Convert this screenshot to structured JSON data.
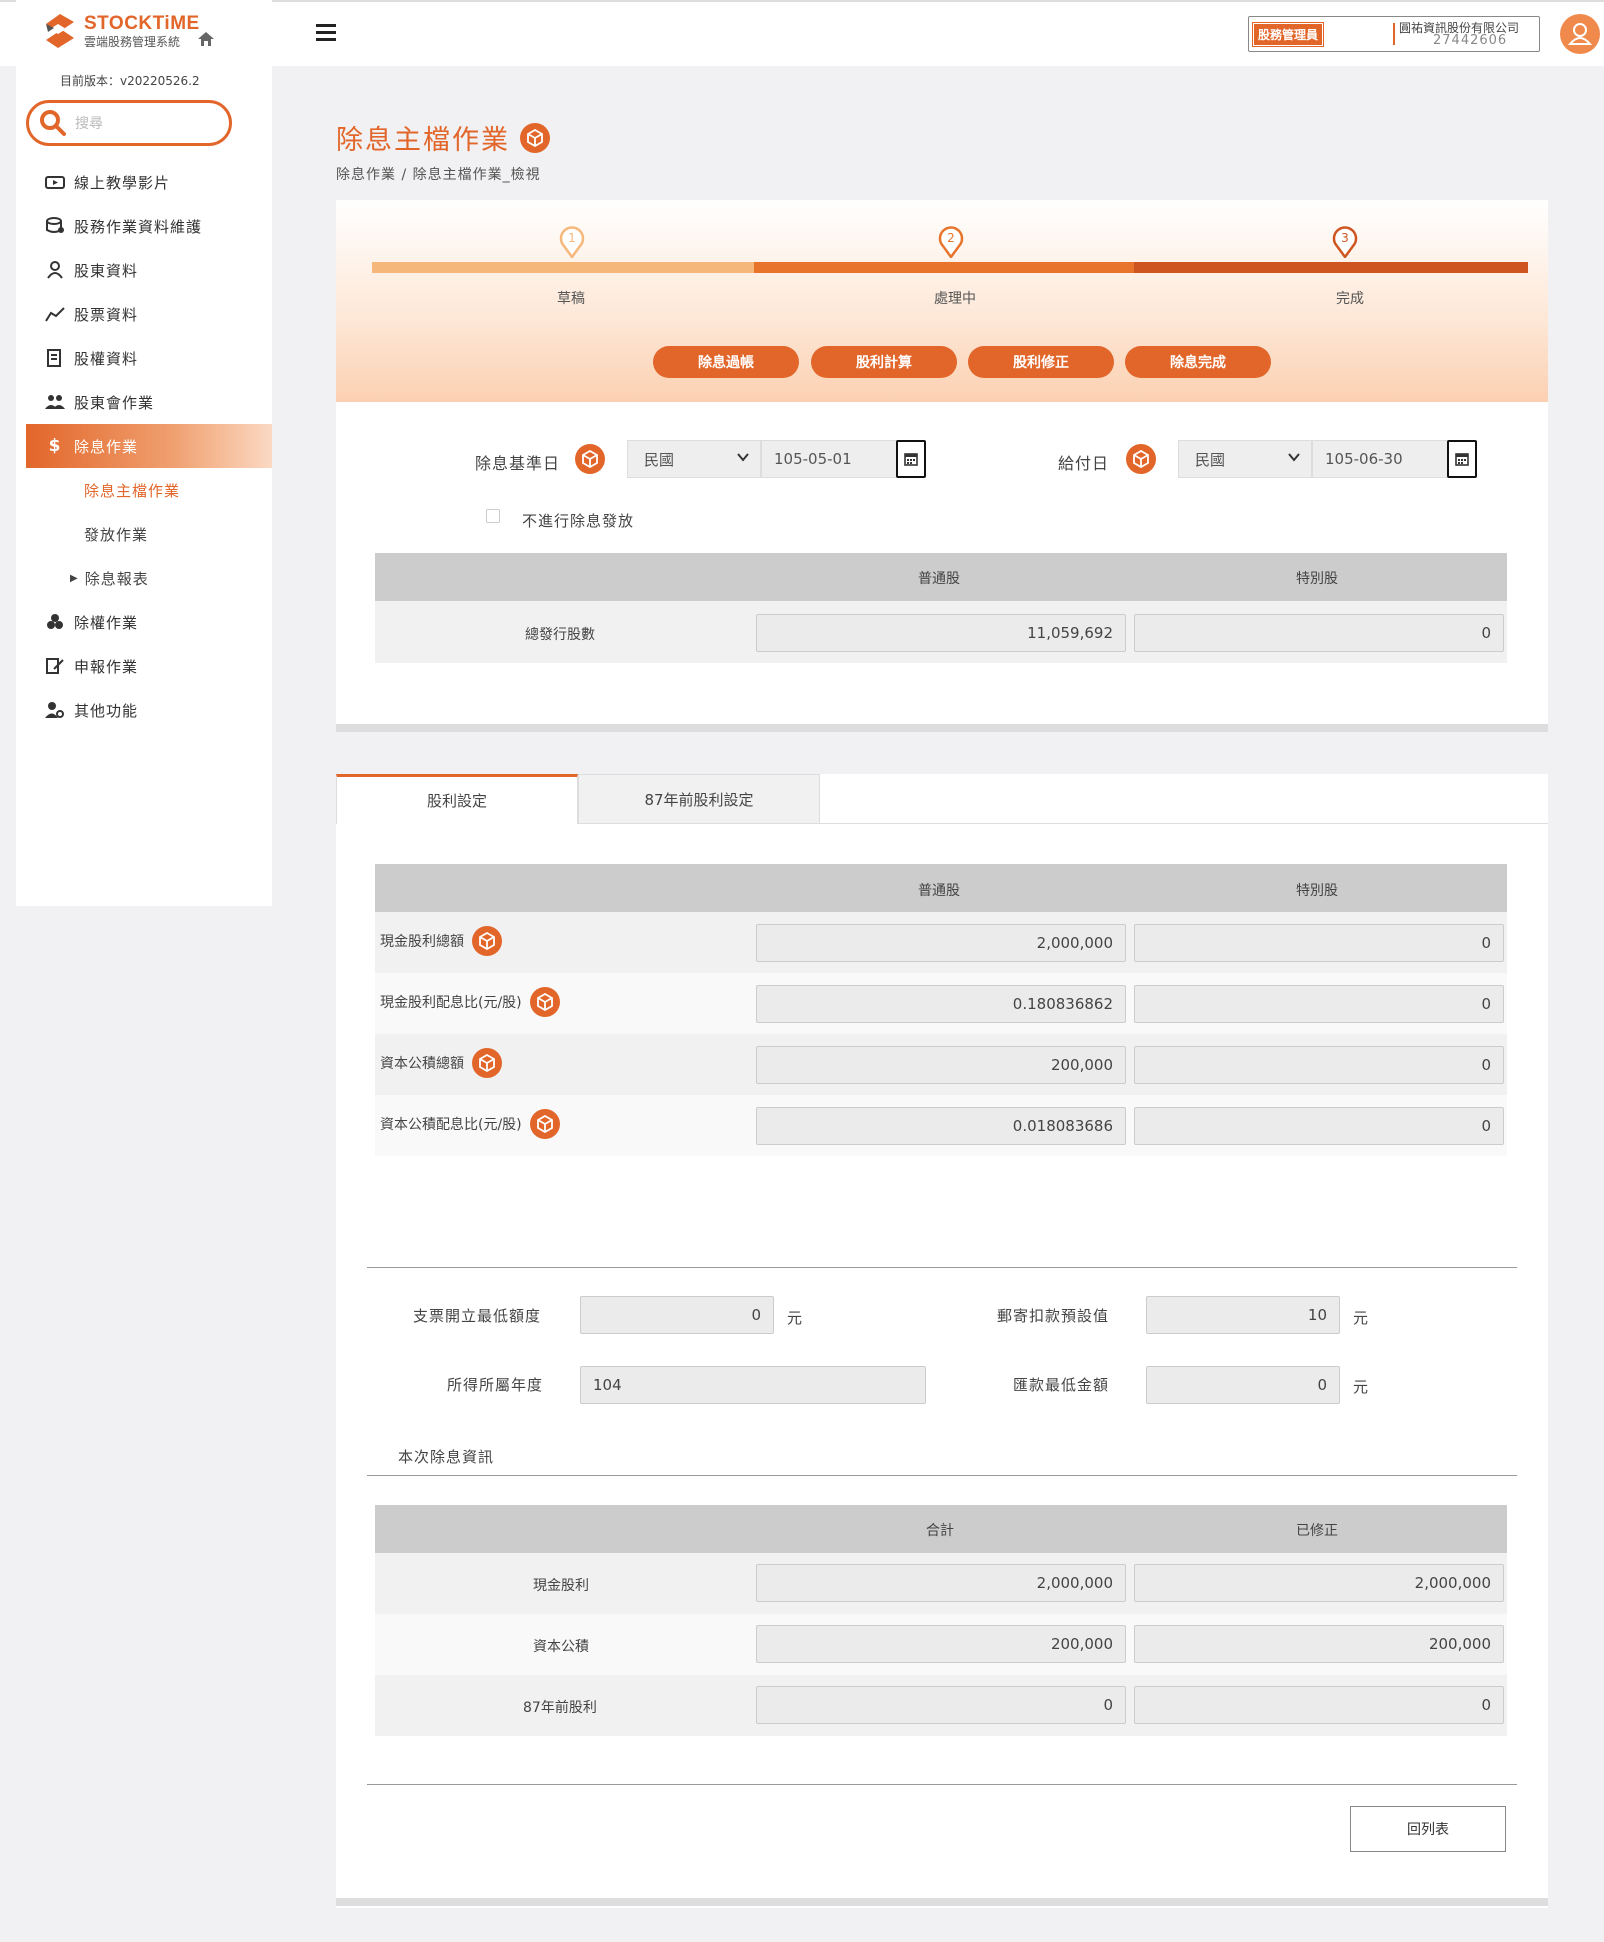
{
  "app": {
    "brand": "STOCKTiME",
    "subtitle": "雲端股務管理系統",
    "version": "目前版本：v20220526.2"
  },
  "search": {
    "placeholder": "搜尋"
  },
  "sidebar": {
    "items": [
      {
        "label": "線上教學影片"
      },
      {
        "label": "股務作業資料維護"
      },
      {
        "label": "股東資料"
      },
      {
        "label": "股票資料"
      },
      {
        "label": "股權資料"
      },
      {
        "label": "股東會作業"
      },
      {
        "label": "除息作業"
      },
      {
        "label": "除權作業"
      },
      {
        "label": "申報作業"
      },
      {
        "label": "其他功能"
      }
    ],
    "sub_items": [
      {
        "label": "除息主檔作業"
      },
      {
        "label": "發放作業"
      },
      {
        "label": "除息報表"
      }
    ]
  },
  "header": {
    "role": "股務管理員",
    "company": "圓祐資訊股份有限公司",
    "company_id": "27442606"
  },
  "page": {
    "title": "除息主檔作業",
    "breadcrumb": "除息作業  /  除息主檔作業_檢視"
  },
  "stepper": {
    "steps": [
      {
        "num": "1",
        "label": "草稿"
      },
      {
        "num": "2",
        "label": "處理中"
      },
      {
        "num": "3",
        "label": "完成"
      }
    ],
    "colors": {
      "step1": "#f5b87a",
      "step2": "#e8742c",
      "step3": "#cf5520"
    },
    "actions": [
      "除息過帳",
      "股利計算",
      "股利修正",
      "除息完成"
    ]
  },
  "form": {
    "base_date_label": "除息基準日",
    "base_era": "民國",
    "base_date": "105-05-01",
    "pay_date_label": "給付日",
    "pay_era": "民國",
    "pay_date": "105-06-30",
    "no_dividend_label": "不進行除息發放",
    "share_table": {
      "col1": "普通股",
      "col2": "特別股",
      "row_label": "總發行股數",
      "common": "11,059,692",
      "special": "0"
    }
  },
  "tabs": [
    "股利設定",
    "87年前股利設定"
  ],
  "dividend_table": {
    "col1": "普通股",
    "col2": "特別股",
    "rows": [
      {
        "label": "現金股利總額",
        "common": "2,000,000",
        "special": "0"
      },
      {
        "label": "現金股利配息比(元/股)",
        "common": "0.180836862",
        "special": "0"
      },
      {
        "label": "資本公積總額",
        "common": "200,000",
        "special": "0"
      },
      {
        "label": "資本公積配息比(元/股)",
        "common": "0.018083686",
        "special": "0"
      }
    ]
  },
  "settings": {
    "check_min_label": "支票開立最低額度",
    "check_min": "0",
    "postal_label": "郵寄扣款預設值",
    "postal": "10",
    "income_year_label": "所得所屬年度",
    "income_year": "104",
    "remit_min_label": "匯款最低金額",
    "remit_min": "0",
    "unit": "元"
  },
  "summary": {
    "title": "本次除息資訊",
    "col1": "合計",
    "col2": "已修正",
    "rows": [
      {
        "label": "現金股利",
        "total": "2,000,000",
        "fixed": "2,000,000"
      },
      {
        "label": "資本公積",
        "total": "200,000",
        "fixed": "200,000"
      },
      {
        "label": "87年前股利",
        "total": "0",
        "fixed": "0"
      }
    ]
  },
  "back_button": "回列表",
  "colors": {
    "accent": "#e2662a"
  }
}
